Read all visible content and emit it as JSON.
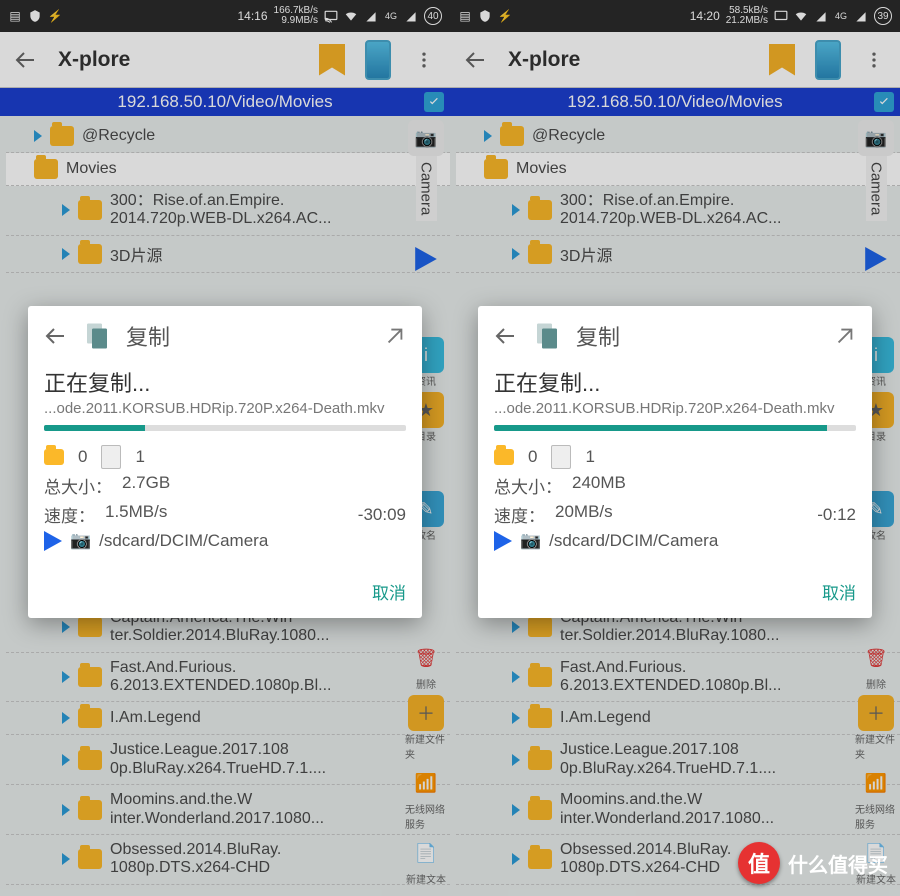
{
  "watermark": "什么值得买",
  "screens": [
    {
      "status": {
        "time": "14:16",
        "speed_top": "166.7kB/s",
        "speed_bot": "9.9MB/s",
        "badge": "40"
      },
      "appbar": {
        "title": "X-plore"
      },
      "path": "192.168.50.10/Video/Movies",
      "camera_label": "Camera",
      "folders": {
        "recycle": "@Recycle",
        "movies": "Movies",
        "item_300": "300：Rise.of.an.Empire.\n2014.720p.WEB-DL.x264.AC...",
        "item_3d": "3D片源",
        "item_cap": "Captain.America.The.Win\nter.Soldier.2014.BluRay.1080...",
        "item_ff": "Fast.And.Furious.\n6.2013.EXTENDED.1080p.Bl...",
        "item_iam": "I.Am.Legend",
        "item_jl": "Justice.League.2017.108\n0p.BluRay.x264.TrueHD.7.1....",
        "item_moo": "Moomins.and.the.W\ninter.Wonderland.2017.1080...",
        "item_obs": "Obsessed.2014.BluRay.\n1080p.DTS.x264-CHD"
      },
      "dock": {
        "info": "资讯",
        "bookmark": "目录",
        "rename": "改名",
        "delete": "删除",
        "newfolder": "新建文件夹",
        "wifi": "无线网络服务",
        "newfile": "新建文本"
      },
      "dialog": {
        "title": "复制",
        "status": "正在复制...",
        "filename": "...ode.2011.KORSUB.HDRip.720P.x264-Death.mkv",
        "progress_pct": 28,
        "folder_count": "0",
        "file_count": "1",
        "size_label": "总大小：",
        "size_value": "2.7GB",
        "speed_label": "速度：",
        "speed_value": "1.5MB/s",
        "eta": "-30:09",
        "destination": "/sdcard/DCIM/Camera",
        "cancel": "取消"
      }
    },
    {
      "status": {
        "time": "14:20",
        "speed_top": "58.5kB/s",
        "speed_bot": "21.2MB/s",
        "badge": "39"
      },
      "appbar": {
        "title": "X-plore"
      },
      "path": "192.168.50.10/Video/Movies",
      "camera_label": "Camera",
      "folders": {
        "recycle": "@Recycle",
        "movies": "Movies",
        "item_300": "300：Rise.of.an.Empire.\n2014.720p.WEB-DL.x264.AC...",
        "item_3d": "3D片源",
        "item_cap": "Captain.America.The.Win\nter.Soldier.2014.BluRay.1080...",
        "item_ff": "Fast.And.Furious.\n6.2013.EXTENDED.1080p.Bl...",
        "item_iam": "I.Am.Legend",
        "item_jl": "Justice.League.2017.108\n0p.BluRay.x264.TrueHD.7.1....",
        "item_moo": "Moomins.and.the.W\ninter.Wonderland.2017.1080...",
        "item_obs": "Obsessed.2014.BluRay.\n1080p.DTS.x264-CHD"
      },
      "dock": {
        "info": "资讯",
        "bookmark": "目录",
        "rename": "改名",
        "delete": "删除",
        "newfolder": "新建文件夹",
        "wifi": "无线网络服务",
        "newfile": "新建文本"
      },
      "dialog": {
        "title": "复制",
        "status": "正在复制...",
        "filename": "...ode.2011.KORSUB.HDRip.720P.x264-Death.mkv",
        "progress_pct": 92,
        "folder_count": "0",
        "file_count": "1",
        "size_label": "总大小：",
        "size_value": "240MB",
        "speed_label": "速度：",
        "speed_value": "20MB/s",
        "eta": "-0:12",
        "destination": "/sdcard/DCIM/Camera",
        "cancel": "取消"
      }
    }
  ]
}
